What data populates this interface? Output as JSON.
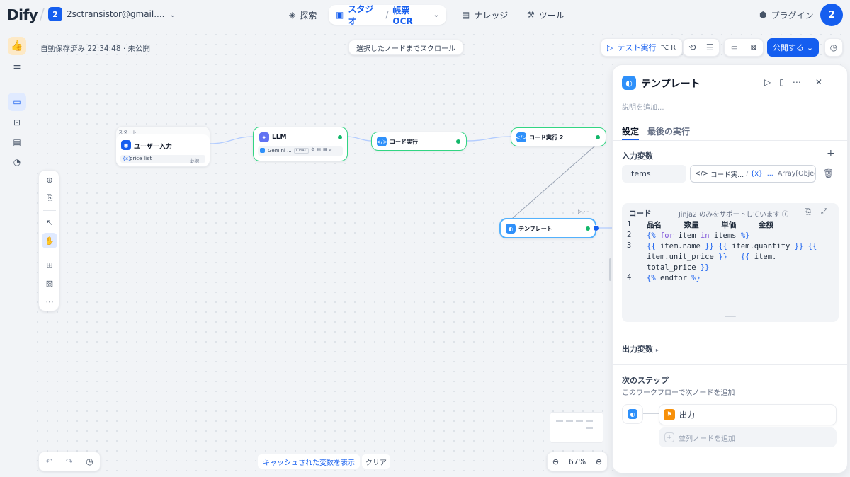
{
  "topbar": {
    "logo": "Dify",
    "workspace_badge": "2",
    "workspace_name": "2sctransistor@gmail....",
    "nav": {
      "explore": "探索",
      "studio": "スタジオ",
      "app_name": "帳票OCR",
      "knowledge": "ナレッジ",
      "tools": "ツール",
      "plugins": "プラグイン"
    },
    "avatar": "2"
  },
  "toolbar": {
    "autosave": "自動保存済み 22:34:48 · 未公開",
    "scroll_to_node": "選択したノードまでスクロール",
    "test_run": "テスト実行",
    "shortcut": "⌥ R",
    "publish": "公開する"
  },
  "nodes": {
    "start_header": "スタート",
    "user_input": "ユーザー入力",
    "user_input_var": "price_list",
    "user_input_required": "必須",
    "llm": "LLM",
    "llm_model": "Gemini ...",
    "llm_mode": "CHAT",
    "code1": "コード実行",
    "code2": "コード実行 2",
    "template": "テンプレート"
  },
  "bottom": {
    "show_cached": "キャッシュされた変数を表示",
    "clear": "クリア",
    "zoom": "67%"
  },
  "panel": {
    "title": "テンプレート",
    "desc_placeholder": "説明を追加...",
    "tabs": [
      "設定",
      "最後の実行"
    ],
    "input_vars_label": "入力変数",
    "var_name": "items",
    "var_source": "コード実...",
    "var_ref": "i...",
    "var_type": "Array[Object]",
    "code_label": "コード",
    "jinja_note": "Jinja2 のみをサポートしています",
    "code_lines": {
      "l1_num": "1",
      "l1": "品名     数量     単価     金額",
      "l2_num": "2",
      "l3_num": "3",
      "l4_num": "4"
    },
    "output_vars_label": "出力変数",
    "next_step_label": "次のステップ",
    "next_step_desc": "このワークフローで次ノードを追加",
    "next_node": "出力",
    "add_parallel": "並列ノードを追加"
  },
  "colors": {
    "accent": "#155eef",
    "success": "#12b76a"
  }
}
